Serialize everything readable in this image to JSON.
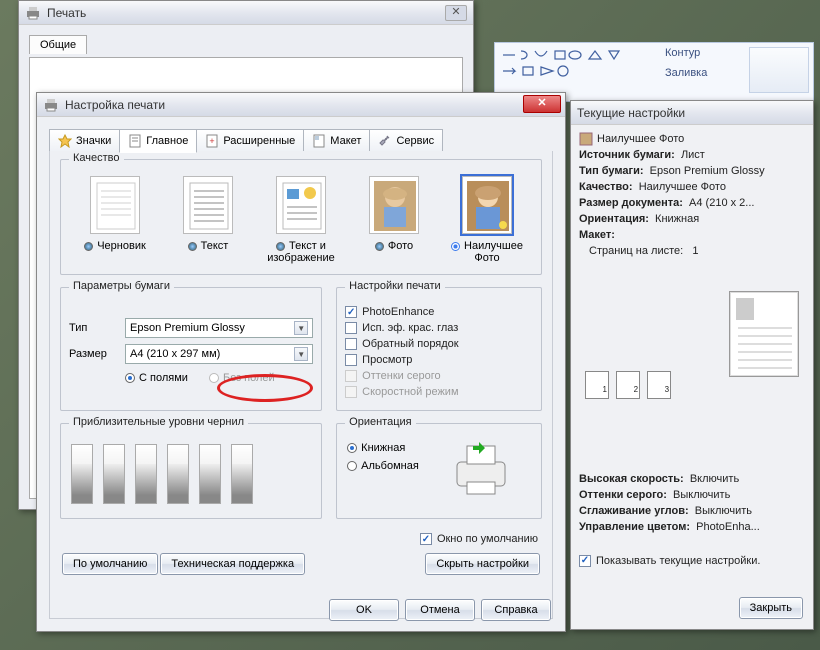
{
  "ribbon": {
    "contour": "Контур",
    "fill": "Заливка"
  },
  "print_window": {
    "title": "Печать",
    "tab_general": "Общие"
  },
  "settings_window": {
    "title": "Настройка печати",
    "tabs": {
      "favorites": "Значки",
      "main": "Главное",
      "advanced": "Расширенные",
      "layout": "Макет",
      "service": "Сервис"
    },
    "quality": {
      "legend": "Качество",
      "draft": "Черновик",
      "text": "Текст",
      "text_image": "Текст и изображение",
      "photo": "Фото",
      "best_photo": "Наилучшее Фото"
    },
    "paper": {
      "legend": "Параметры бумаги",
      "type_label": "Тип",
      "type_value": "Epson Premium Glossy",
      "size_label": "Размер",
      "size_value": "A4 (210 x 297 мм)",
      "with_margins": "С полями",
      "borderless": "Без полей"
    },
    "print_opts": {
      "legend": "Настройки печати",
      "photoenhance": "PhotoEnhance",
      "redeye": "Исп. эф. крас. глаз",
      "reverse": "Обратный порядок",
      "preview": "Просмотр",
      "grayscale": "Оттенки серого",
      "fast": "Скоростной режим"
    },
    "ink": {
      "legend": "Приблизительные уровни чернил"
    },
    "orientation": {
      "legend": "Ориентация",
      "portrait": "Книжная",
      "landscape": "Альбомная"
    },
    "default_window": "Окно по умолчанию",
    "btn_defaults": "По умолчанию",
    "btn_support": "Техническая поддержка",
    "btn_hide": "Скрыть настройки",
    "btn_ok": "OK",
    "btn_cancel": "Отмена",
    "btn_help": "Справка"
  },
  "info_panel": {
    "title": "Текущие настройки",
    "preset": "Наилучшее Фото",
    "source_k": "Источник бумаги:",
    "source_v": "Лист",
    "type_k": "Тип бумаги:",
    "type_v": "Epson Premium Glossy",
    "quality_k": "Качество:",
    "quality_v": "Наилучшее Фото",
    "docsize_k": "Размер документа:",
    "docsize_v": "A4 (210 x 2...",
    "orient_k": "Ориентация:",
    "orient_v": "Книжная",
    "layout_k": "Макет:",
    "pps_k": "Страниц на листе:",
    "pps_v": "1",
    "speed_k": "Высокая скорость:",
    "speed_v": "Включить",
    "gray_k": "Оттенки серого:",
    "gray_v": "Выключить",
    "smooth_k": "Сглаживание углов:",
    "smooth_v": "Выключить",
    "cm_k": "Управление цветом:",
    "cm_v": "PhotoEnha...",
    "show_current": "Показывать текущие настройки.",
    "btn_close": "Закрыть",
    "mini": {
      "a": "1",
      "b": "2",
      "c": "3"
    }
  }
}
